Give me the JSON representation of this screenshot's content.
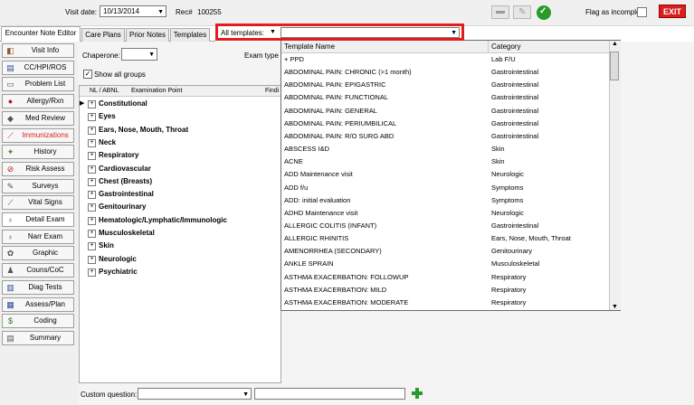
{
  "header": {
    "visit_date_label": "Visit date:",
    "visit_date_value": "10/13/2014",
    "rec_label": "Rec#",
    "rec_value": "100255",
    "flag_incomplete_label": "Flag as incomplete",
    "exit_label": "EXIT"
  },
  "tabs": [
    {
      "label": "Encounter Note Editor"
    },
    {
      "label": "Care Plans"
    },
    {
      "label": "Prior Notes"
    },
    {
      "label": "Templates"
    }
  ],
  "templates_filter": {
    "label": "All templates:",
    "value": ""
  },
  "sidebar": {
    "items": [
      {
        "label": "Visit Info",
        "icon": "visit-info-icon"
      },
      {
        "label": "CC/HPI/ROS",
        "icon": "cc-hpi-icon"
      },
      {
        "label": "Problem List",
        "icon": "problem-list-icon"
      },
      {
        "label": "Allergy/Rxn",
        "icon": "allergy-icon"
      },
      {
        "label": "Med Review",
        "icon": "med-review-icon"
      },
      {
        "label": "Immunizations",
        "icon": "syringe-icon"
      },
      {
        "label": "History",
        "icon": "history-icon"
      },
      {
        "label": "Risk Assess",
        "icon": "risk-icon"
      },
      {
        "label": "Surveys",
        "icon": "survey-icon"
      },
      {
        "label": "Vital Signs",
        "icon": "vitals-icon"
      },
      {
        "label": "Detail Exam",
        "icon": "stethoscope-icon"
      },
      {
        "label": "Narr Exam",
        "icon": "stethoscope-icon"
      },
      {
        "label": "Graphic",
        "icon": "graphic-icon"
      },
      {
        "label": "Couns/CoC",
        "icon": "counsel-icon"
      },
      {
        "label": "Diag Tests",
        "icon": "tests-icon"
      },
      {
        "label": "Assess/Plan",
        "icon": "plan-icon"
      },
      {
        "label": "Coding",
        "icon": "dollar-icon"
      },
      {
        "label": "Summary",
        "icon": "summary-icon"
      }
    ],
    "active_index": 10,
    "red_index": 5
  },
  "exam": {
    "chaperone_label": "Chaperone:",
    "chaperone_value": "",
    "exam_type_label": "Exam type",
    "show_all_groups_label": "Show all groups",
    "show_all_groups_checked": true,
    "columns": [
      "NL / ABNL",
      "Examination Point",
      "Findi"
    ],
    "rows": [
      "Constitutional",
      "Eyes",
      "Ears, Nose, Mouth, Throat",
      "Neck",
      "Respiratory",
      "Cardiovascular",
      "Chest (Breasts)",
      "Gastrointestinal",
      "Genitourinary",
      "Hematologic/Lymphatic/Immunologic",
      "Musculoskeletal",
      "Skin",
      "Neurologic",
      "Psychiatric"
    ]
  },
  "template_list": {
    "columns": [
      "Template Name",
      "Category"
    ],
    "rows": [
      {
        "name": "+ PPD",
        "category": "Lab F/U"
      },
      {
        "name": "ABDOMINAL PAIN: CHRONIC  (>1 month)",
        "category": "Gastrointestinal"
      },
      {
        "name": "ABDOMINAL PAIN: EPIGASTRIC",
        "category": "Gastrointestinal"
      },
      {
        "name": "ABDOMINAL PAIN: FUNCTIONAL",
        "category": "Gastrointestinal"
      },
      {
        "name": "ABDOMINAL PAIN: GENERAL",
        "category": "Gastrointestinal"
      },
      {
        "name": "ABDOMINAL PAIN: PERIUMBILICAL",
        "category": "Gastrointestinal"
      },
      {
        "name": "ABDOMINAL PAIN: R/O SURG ABD",
        "category": "Gastrointestinal"
      },
      {
        "name": "ABSCESS I&D",
        "category": "Skin"
      },
      {
        "name": "ACNE",
        "category": "Skin"
      },
      {
        "name": "ADD Maintenance visit",
        "category": "Neurologic"
      },
      {
        "name": "ADD f/u",
        "category": "Symptoms"
      },
      {
        "name": "ADD: initial evaluation",
        "category": "Symptoms"
      },
      {
        "name": "ADHD Maintenance visit",
        "category": "Neurologic"
      },
      {
        "name": "ALLERGIC COLITIS (INFANT)",
        "category": "Gastrointestinal"
      },
      {
        "name": "ALLERGIC RHINITIS",
        "category": "Ears, Nose, Mouth, Throat"
      },
      {
        "name": "AMENORRHEA (SECONDARY)",
        "category": "Genitourinary"
      },
      {
        "name": "ANKLE SPRAIN",
        "category": "Musculoskeletal"
      },
      {
        "name": "ASTHMA EXACERBATION: FOLLOWUP",
        "category": "Respiratory"
      },
      {
        "name": "ASTHMA EXACERBATION: MILD",
        "category": "Respiratory"
      },
      {
        "name": "ASTHMA EXACERBATION: MODERATE",
        "category": "Respiratory"
      }
    ]
  },
  "footer": {
    "custom_question_label": "Custom question:",
    "custom_question_value": ""
  },
  "colors": {
    "exit": "#d81e1e",
    "highlight_box": "#e51c1c",
    "check_green": "#2a9a2a"
  }
}
